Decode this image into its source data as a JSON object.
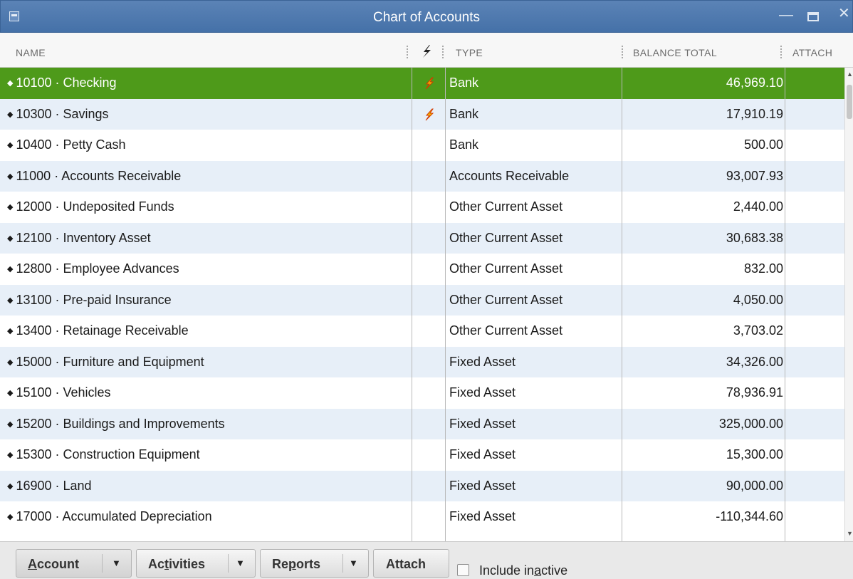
{
  "window": {
    "title": "Chart of Accounts"
  },
  "columns": {
    "name": "NAME",
    "type": "TYPE",
    "balance": "BALANCE TOTAL",
    "attach": "ATTACH"
  },
  "accounts": [
    {
      "name": "10100 · Checking",
      "online": true,
      "type": "Bank",
      "balance": "46,969.10",
      "selected": true
    },
    {
      "name": "10300 · Savings",
      "online": true,
      "type": "Bank",
      "balance": "17,910.19"
    },
    {
      "name": "10400 · Petty Cash",
      "online": false,
      "type": "Bank",
      "balance": "500.00"
    },
    {
      "name": "11000 · Accounts Receivable",
      "online": false,
      "type": "Accounts Receivable",
      "balance": "93,007.93"
    },
    {
      "name": "12000 · Undeposited Funds",
      "online": false,
      "type": "Other Current Asset",
      "balance": "2,440.00"
    },
    {
      "name": "12100 · Inventory Asset",
      "online": false,
      "type": "Other Current Asset",
      "balance": "30,683.38"
    },
    {
      "name": "12800 · Employee Advances",
      "online": false,
      "type": "Other Current Asset",
      "balance": "832.00"
    },
    {
      "name": "13100 · Pre-paid Insurance",
      "online": false,
      "type": "Other Current Asset",
      "balance": "4,050.00"
    },
    {
      "name": "13400 · Retainage Receivable",
      "online": false,
      "type": "Other Current Asset",
      "balance": "3,703.02"
    },
    {
      "name": "15000 · Furniture and Equipment",
      "online": false,
      "type": "Fixed Asset",
      "balance": "34,326.00"
    },
    {
      "name": "15100 · Vehicles",
      "online": false,
      "type": "Fixed Asset",
      "balance": "78,936.91"
    },
    {
      "name": "15200 · Buildings and Improvements",
      "online": false,
      "type": "Fixed Asset",
      "balance": "325,000.00"
    },
    {
      "name": "15300 · Construction Equipment",
      "online": false,
      "type": "Fixed Asset",
      "balance": "15,300.00"
    },
    {
      "name": "16900 · Land",
      "online": false,
      "type": "Fixed Asset",
      "balance": "90,000.00"
    },
    {
      "name": "17000 · Accumulated Depreciation",
      "online": false,
      "type": "Fixed Asset",
      "balance": "-110,344.60"
    }
  ],
  "footer": {
    "account_label": "Account",
    "activities_label": "Activities",
    "reports_label": "Reports",
    "attach_label": "Attach",
    "include_inactive_label": "Include inactive",
    "include_inactive_checked": false
  },
  "colors": {
    "selected_row": "#4e9a1a",
    "alt_row": "#e7eff8",
    "titlebar": "#4f78ad",
    "online_icon": "#f5c000"
  },
  "icons": {
    "column_online": "lightning-icon",
    "row_online": "online-banking-icon"
  }
}
